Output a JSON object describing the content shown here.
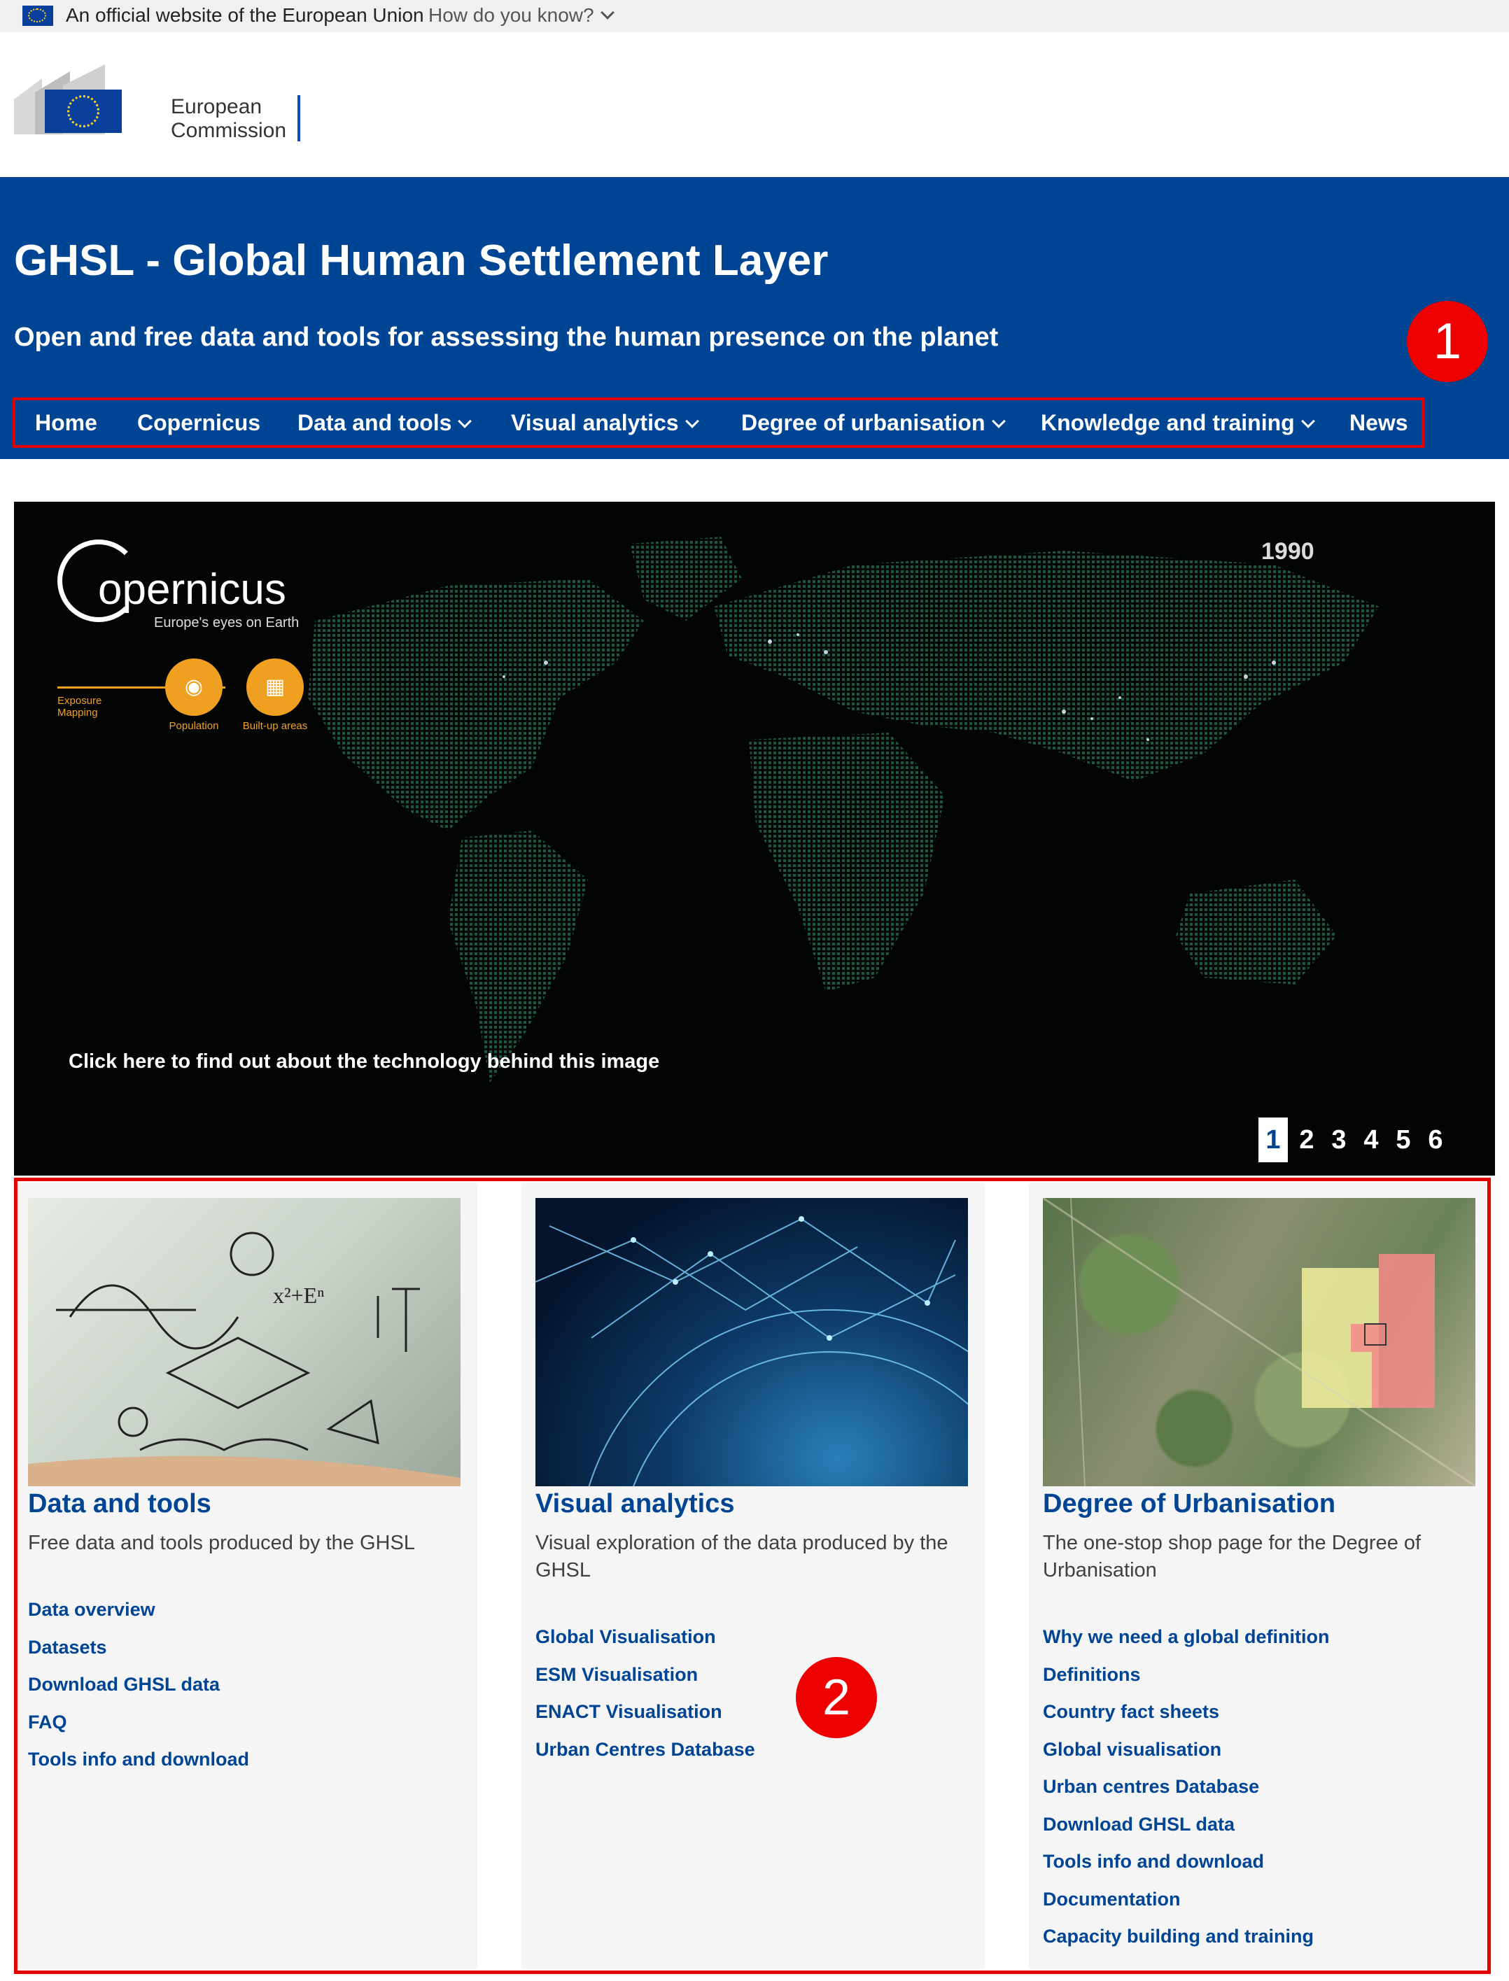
{
  "official_bar": {
    "text": "An official website of the European Union",
    "how_link": "How do you know?"
  },
  "logo": {
    "line1": "European",
    "line2": "Commission"
  },
  "header": {
    "title": "GHSL - Global Human Settlement Layer",
    "subtitle": "Open and free data and tools for assessing the human presence on the planet"
  },
  "markers": {
    "one": "1",
    "two": "2"
  },
  "nav": {
    "items": [
      {
        "label": "Home"
      },
      {
        "label": "Copernicus"
      },
      {
        "label": "Data and tools"
      },
      {
        "label": "Visual analytics"
      },
      {
        "label": "Degree of urbanisation"
      },
      {
        "label": "Knowledge and training"
      },
      {
        "label": "News"
      }
    ]
  },
  "hero": {
    "year": "1990",
    "caption": "Click here to find out about the technology behind this image",
    "copernicus_word": "opernicus",
    "copernicus_tagline": "Europe's eyes on Earth",
    "exposure_label": "Exposure Mapping",
    "population_label": "Population",
    "builtup_label": "Built-up areas",
    "pages": [
      "1",
      "2",
      "3",
      "4",
      "5",
      "6"
    ],
    "active_page": "1"
  },
  "cards": [
    {
      "title": "Data and tools",
      "description": "Free data and tools produced by the GHSL",
      "links": [
        "Data overview",
        "Datasets",
        "Download GHSL data",
        "FAQ",
        "Tools info and download"
      ]
    },
    {
      "title": "Visual analytics",
      "description": "Visual exploration of the data produced by the GHSL",
      "links": [
        "Global Visualisation",
        "ESM Visualisation",
        "ENACT Visualisation",
        "Urban Centres Database"
      ]
    },
    {
      "title": "Degree of Urbanisation",
      "description": "The one-stop shop page for the Degree of Urbanisation",
      "links": [
        "Why we need a global definition",
        "Definitions",
        "Country fact sheets",
        "Global visualisation",
        "Urban centres Database",
        "Download GHSL data",
        "Tools info and download",
        "Documentation",
        "Capacity building and training"
      ]
    }
  ],
  "colors": {
    "header_bg": "#004494",
    "link": "#004494",
    "annotation_red": "#e00000"
  }
}
